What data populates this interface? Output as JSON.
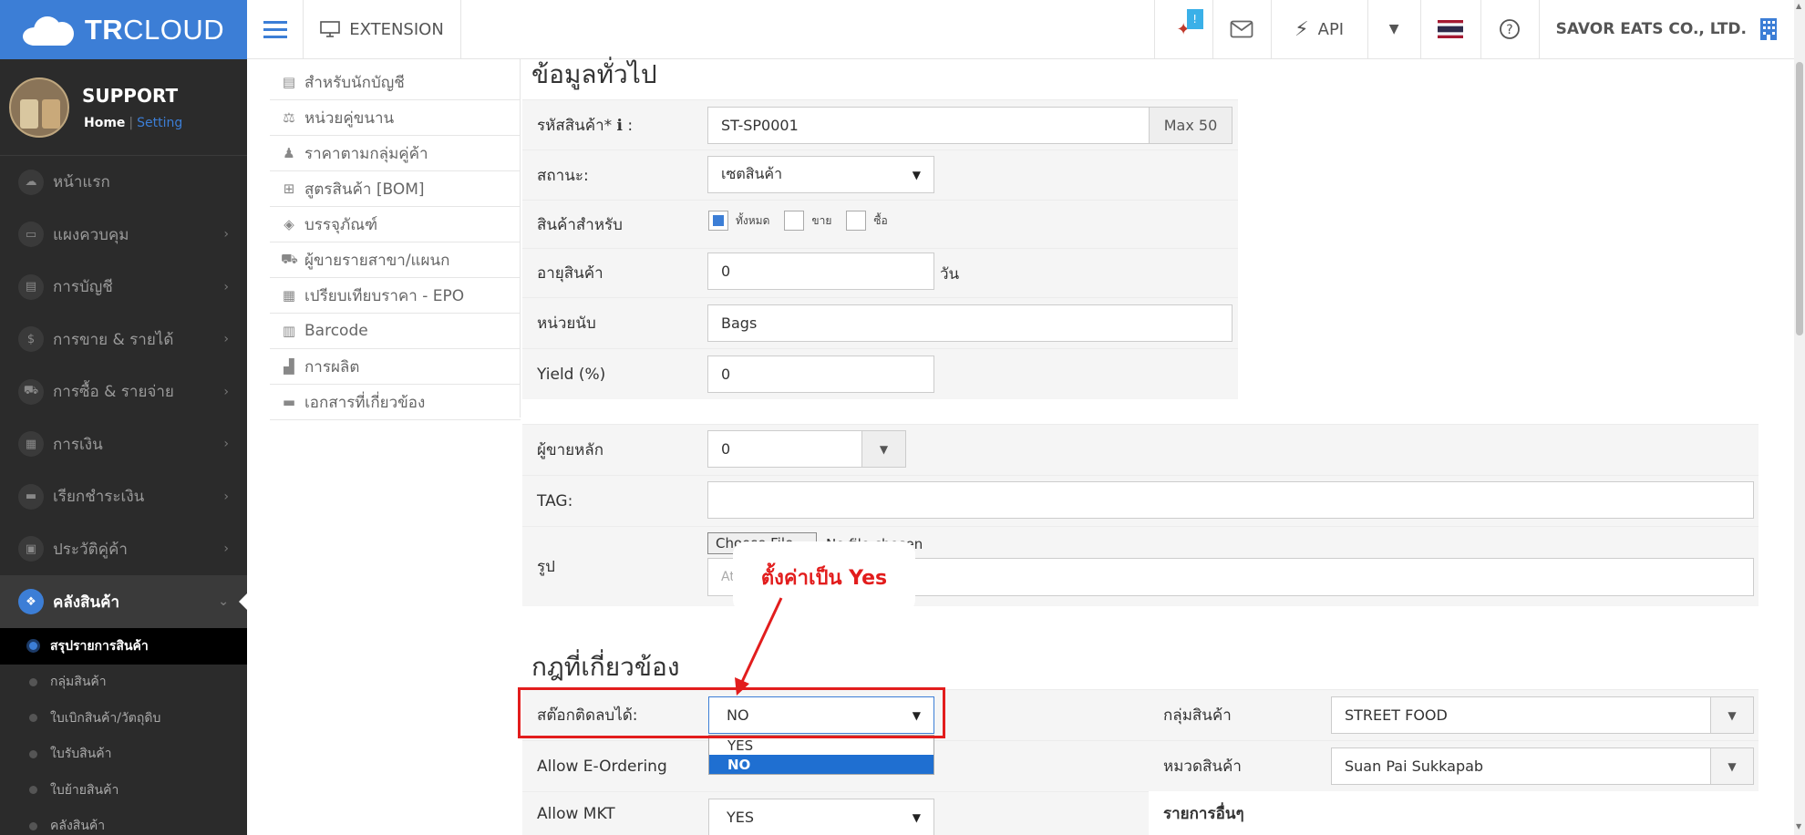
{
  "brand": {
    "logo_text_bold": "TR",
    "logo_text": "CLOUD"
  },
  "topbar": {
    "extension_label": "EXTENSION",
    "notification_count": "!",
    "api_label": "API",
    "company_name": "SAVOR EATS CO., LTD."
  },
  "profile": {
    "name": "SUPPORT",
    "home_link": "Home",
    "separator": "|",
    "setting_link": "Setting"
  },
  "sidebar": {
    "items": [
      {
        "label": "หน้าแรก",
        "icon": "cloud-icon"
      },
      {
        "label": "แผงควบคุม",
        "icon": "monitor-icon"
      },
      {
        "label": "การบัญชี",
        "icon": "book-icon"
      },
      {
        "label": "การขาย & รายได้",
        "icon": "dollar-icon"
      },
      {
        "label": "การซื้อ & รายจ่าย",
        "icon": "cart-icon"
      },
      {
        "label": "การเงิน",
        "icon": "calendar-icon"
      },
      {
        "label": "เรียกชำระเงิน",
        "icon": "card-icon"
      },
      {
        "label": "ประวัติคู่ค้า",
        "icon": "contact-icon"
      },
      {
        "label": "คลังสินค้า",
        "icon": "cubes-icon"
      }
    ],
    "sub_items": [
      "สรุปรายการสินค้า",
      "กลุ่มสินค้า",
      "ใบเบิกสินค้า/วัตถุดิบ",
      "ใบรับสินค้า",
      "ใบย้ายสินค้า",
      "คลังสินค้า"
    ]
  },
  "subnav": {
    "items": [
      {
        "label": "สำหรับนักบัญชี",
        "icon": "book-icon"
      },
      {
        "label": "หน่วยคู่ขนาน",
        "icon": "balance-scale-icon"
      },
      {
        "label": "ราคาตามกลุ่มคู่ค้า",
        "icon": "users-icon"
      },
      {
        "label": "สูตรสินค้า [BOM]",
        "icon": "sitemap-icon"
      },
      {
        "label": "บรรจุภัณฑ์",
        "icon": "dropbox-icon"
      },
      {
        "label": "ผู้ขายรายสาขา/แผนก",
        "icon": "cart-icon"
      },
      {
        "label": "เปรียบเทียบราคา - EPO",
        "icon": "table-icon"
      },
      {
        "label": "Barcode",
        "icon": "barcode-icon"
      },
      {
        "label": "การผลิต",
        "icon": "industry-icon"
      },
      {
        "label": "เอกสารที่เกี่ยวข้อง",
        "icon": "folder-icon"
      }
    ]
  },
  "form": {
    "section_title": "ข้อมูลทั่วไป",
    "product_code_label": "รหัสสินค้า* ℹ :",
    "product_code_value": "ST-SP0001",
    "product_code_max": "Max 50",
    "status_label": "สถานะ:",
    "status_value": "เซตสินค้า",
    "product_for_label": "สินค้าสำหรับ",
    "product_for_options": [
      "ทั้งหมด",
      "ขาย",
      "ซื้อ"
    ],
    "shelf_life_label": "อายุสินค้า",
    "shelf_life_value": "0",
    "shelf_life_unit": "วัน",
    "unit_label": "หน่วยนับ",
    "unit_value": "Bags",
    "yield_label": "Yield (%)",
    "yield_value": "0",
    "main_vendor_label": "ผู้ขายหลัก",
    "main_vendor_value": "0",
    "tag_label": "TAG:",
    "image_label": "รูป",
    "file_button": "Choose File",
    "file_status": "No file chosen",
    "attach_placeholder": "At"
  },
  "rules": {
    "section_title": "กฎที่เกี่ยวข้อง",
    "negative_stock_label": "สต๊อกติดลบได้:",
    "negative_stock_value": "NO",
    "negative_stock_options": [
      "YES",
      "NO"
    ],
    "e_ordering_label": "Allow E-Ordering",
    "mkt_label": "Allow MKT",
    "mkt_value": "YES",
    "product_group_label": "กลุ่มสินค้า",
    "product_group_value": "STREET FOOD",
    "category_label": "หมวดสินค้า",
    "category_value": "Suan Pai Sukkapab",
    "other_label": "รายการอื่นๆ"
  },
  "annotation": {
    "text": "ตั้งค่าเป็น Yes",
    "color": "#e21d1d"
  },
  "colors": {
    "brand": "#3c7ed6",
    "sidebar_bg": "#2b2b2b",
    "dropdown_selected": "#1f6fd1"
  }
}
